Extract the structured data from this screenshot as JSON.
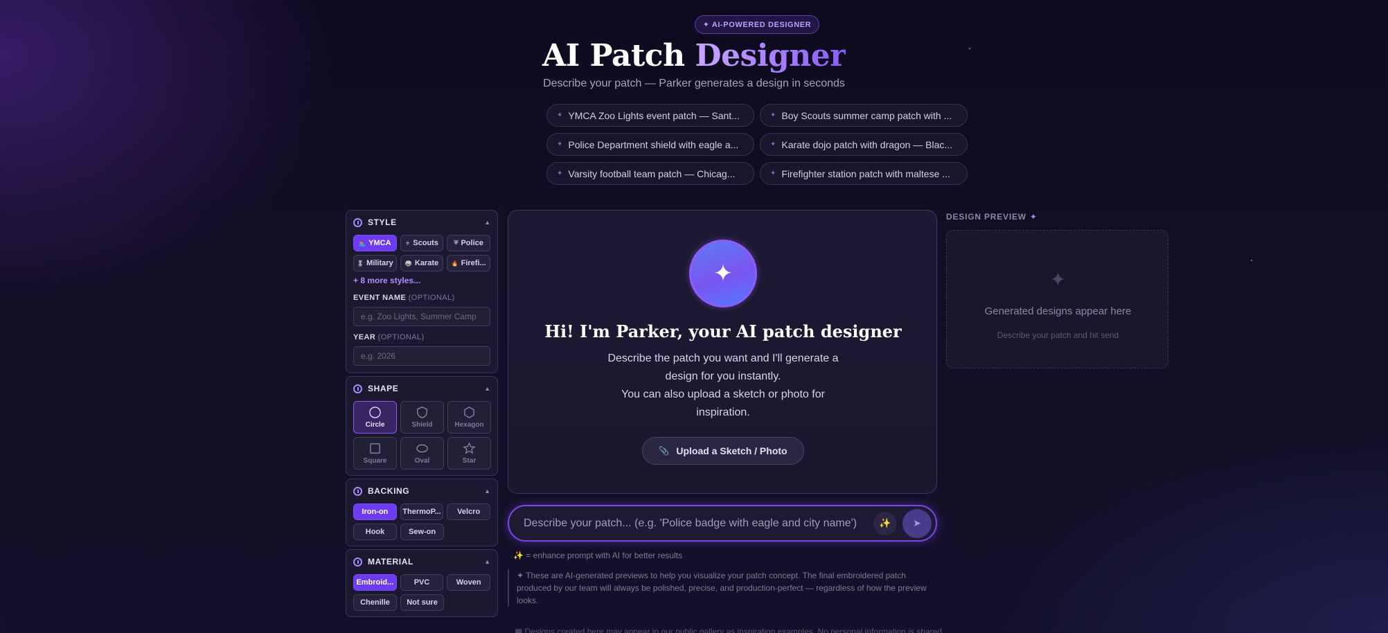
{
  "header": {
    "badge": "✦ AI-POWERED DESIGNER",
    "title_main": "AI Patch ",
    "title_accent": "Designer",
    "subtitle": "Describe your patch — Parker generates a design in seconds"
  },
  "examples": [
    "YMCA Zoo Lights event patch — Sant...",
    "Boy Scouts summer camp patch with ...",
    "Police Department shield with eagle a...",
    "Karate dojo patch with dragon — Blac...",
    "Varsity football team patch — Chicag...",
    "Firefighter station patch with maltese ..."
  ],
  "style": {
    "title": "STYLE",
    "options": [
      {
        "label": "YMCA",
        "icon": "🏊"
      },
      {
        "label": "Scouts",
        "icon": "⚜"
      },
      {
        "label": "Police",
        "icon": "⛨"
      },
      {
        "label": "Military",
        "icon": "🎖"
      },
      {
        "label": "Karate",
        "icon": "🥋"
      },
      {
        "label": "Firefi...",
        "icon": "🔥"
      }
    ],
    "selected": "YMCA",
    "more": "+ 8 more styles...",
    "event_label": "EVENT NAME",
    "event_optional": "(OPTIONAL)",
    "event_placeholder": "e.g. Zoo Lights, Summer Camp",
    "year_label": "YEAR",
    "year_optional": "(OPTIONAL)",
    "year_placeholder": "e.g. 2026"
  },
  "shape": {
    "title": "SHAPE",
    "options": [
      "Circle",
      "Shield",
      "Hexagon",
      "Square",
      "Oval",
      "Star"
    ],
    "selected": "Circle"
  },
  "backing": {
    "title": "BACKING",
    "options": [
      "Iron-on",
      "ThermoP...",
      "Velcro",
      "Hook",
      "Sew-on"
    ],
    "selected": "Iron-on"
  },
  "material": {
    "title": "MATERIAL",
    "options": [
      "Embroid...",
      "PVC",
      "Woven",
      "Chenille",
      "Not sure"
    ],
    "selected": "Embroid..."
  },
  "chat": {
    "greeting": "Hi! I'm Parker, your AI patch designer",
    "line1": "Describe the patch you want and I'll generate a design for you instantly.",
    "line2": "You can also upload a sketch or photo for inspiration.",
    "upload_label": "Upload a Sketch / Photo",
    "avatar_icon": "sparkle-icon"
  },
  "prompt": {
    "placeholder": "Describe your patch... (e.g. 'Police badge with eagle and city name')",
    "hint_text": "= enhance prompt with AI for better results",
    "disclaimer": "✦ These are AI-generated previews to help you visualize your patch concept. The final embroidered patch produced by our team will always be polished, precise, and production-perfect — regardless of how the preview looks.",
    "gallery_note": "▦ Designs created here may appear in our public gallery as inspiration examples. No personal information is shared."
  },
  "preview": {
    "label": "DESIGN PREVIEW",
    "main": "Generated designs appear here",
    "sub": "Describe your patch and hit send"
  },
  "colors": {
    "accent": "#6d3cf0",
    "background": "#120e24",
    "panel": "#1b1830"
  }
}
